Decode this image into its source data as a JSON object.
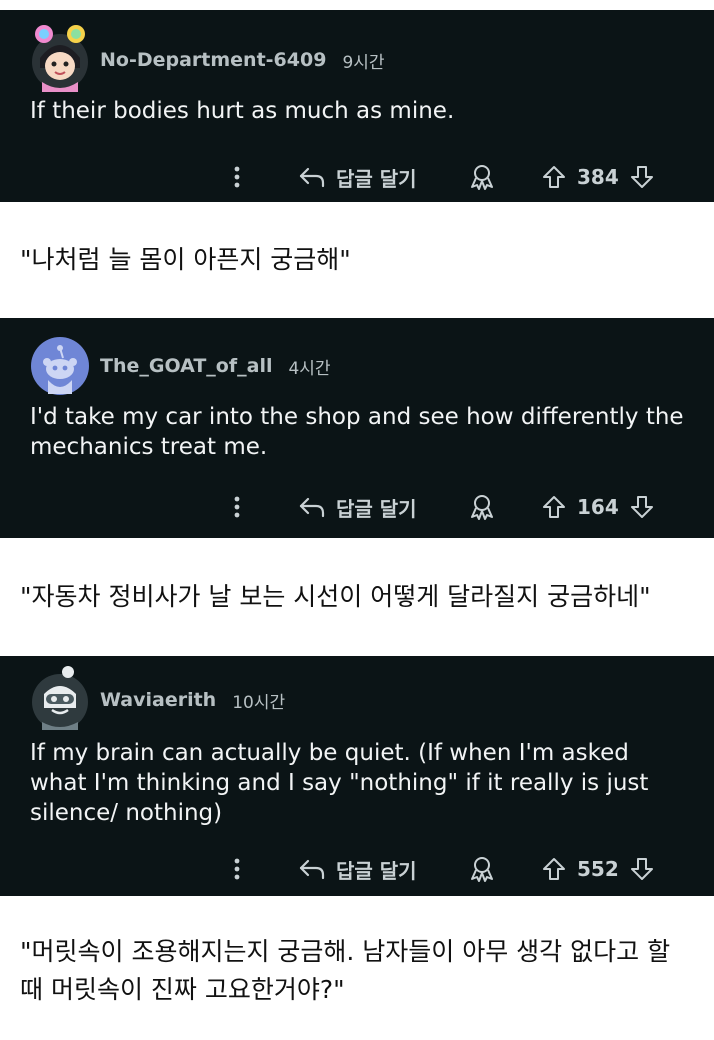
{
  "comments": [
    {
      "username": "No-Department-6409",
      "time": "9시간",
      "body": "If their bodies hurt as much as mine.",
      "reply_label": "답글 달기",
      "votes": "384",
      "translation": "\"나처럼 늘 몸이 아픈지 궁금해\""
    },
    {
      "username": "The_GOAT_of_all",
      "time": "4시간",
      "body": "I'd take my car into the shop and see how differently the mechanics treat me.",
      "reply_label": "답글 달기",
      "votes": "164",
      "translation": "\"자동차 정비사가 날 보는 시선이 어떻게 달라질지 궁금하네\""
    },
    {
      "username": "Waviaerith",
      "time": "10시간",
      "body": "If my brain can actually be quiet. (If when I'm asked what I'm thinking and I say \"nothing\" if it really is just silence/ nothing)",
      "reply_label": "답글 달기",
      "votes": "552",
      "translation": "\"머릿속이 조용해지는지 궁금해. 남자들이 아무 생각 없다고 할 때 머릿속이 진짜 고요한거야?\""
    }
  ],
  "colors": {
    "card_bg": "#0b1416",
    "meta_text": "#b7c0c3",
    "body_text": "#f2f4f5"
  },
  "icons": [
    "more-options-icon",
    "reply-arrow-icon",
    "award-icon",
    "upvote-arrow-icon",
    "downvote-arrow-icon"
  ]
}
